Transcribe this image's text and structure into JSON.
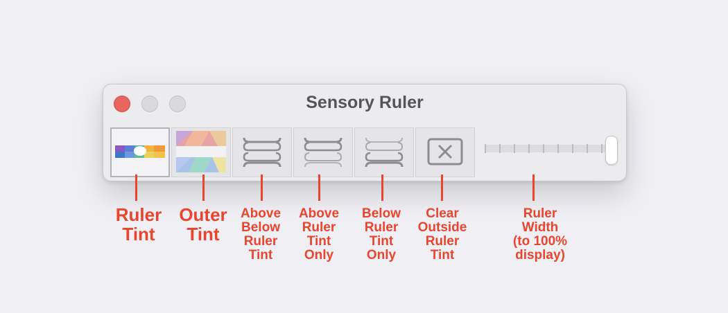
{
  "window": {
    "title": "Sensory Ruler"
  },
  "toolbar": {
    "tools": [
      {
        "id": "ruler-tint",
        "icon": "ruler-tint-icon",
        "selected": true
      },
      {
        "id": "outer-tint",
        "icon": "outer-tint-icon",
        "selected": false
      },
      {
        "id": "above-below-ruler-tint",
        "icon": "above-below-bracket-icon",
        "selected": false
      },
      {
        "id": "above-ruler-tint-only",
        "icon": "above-bracket-icon",
        "selected": false
      },
      {
        "id": "below-ruler-tint-only",
        "icon": "below-bracket-icon",
        "selected": false
      },
      {
        "id": "clear-outside-ruler-tint",
        "icon": "clear-x-icon",
        "selected": false
      }
    ],
    "width_slider": {
      "value_fraction": 1.0
    }
  },
  "annotations": {
    "ruler_tint": "Ruler\nTint",
    "outer_tint": "Outer\nTint",
    "above_below": "Above\nBelow\nRuler\nTint",
    "above_only": "Above\nRuler\nTint\nOnly",
    "below_only": "Below\nRuler\nTint\nOnly",
    "clear_outside": "Clear\nOutside\nRuler\nTint",
    "ruler_width": "Ruler\nWidth\n(to 100%\n display)"
  },
  "colors": {
    "annotation": "#e8452e",
    "close_button": "#e96560",
    "window_bg": "#ececee"
  }
}
